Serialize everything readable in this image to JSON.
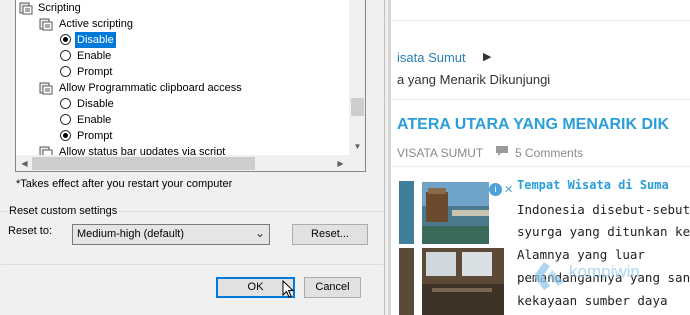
{
  "dialog": {
    "tree": {
      "items": [
        {
          "label": "Scripting",
          "kind": "category"
        },
        {
          "label": "Active scripting",
          "kind": "setting"
        },
        {
          "label": "Disable",
          "kind": "option",
          "checked": true,
          "selected": true
        },
        {
          "label": "Enable",
          "kind": "option",
          "checked": false
        },
        {
          "label": "Prompt",
          "kind": "option",
          "checked": false
        },
        {
          "label": "Allow Programmatic clipboard access",
          "kind": "setting"
        },
        {
          "label": "Disable",
          "kind": "option",
          "checked": false
        },
        {
          "label": "Enable",
          "kind": "option",
          "checked": false
        },
        {
          "label": "Prompt",
          "kind": "option",
          "checked": true
        },
        {
          "label": "Allow status bar updates via script",
          "kind": "setting"
        }
      ]
    },
    "note": "*Takes effect after you restart your computer",
    "reset_group": {
      "title": "Reset custom settings",
      "reset_to_label": "Reset to:",
      "reset_to_value": "Medium-high (default)",
      "reset_button": "Reset..."
    },
    "ok_button": "OK",
    "cancel_button": "Cancel"
  },
  "webpage": {
    "breadcrumb_link": "isata Sumut",
    "breadcrumb_title": "a yang Menarik Dikunjungi",
    "post_title": "ATERA UTARA YANG MENARIK DIK",
    "category": "VISATA SUMUT",
    "comments": "5 Comments",
    "article_heading": "Tempat Wisata di Suma",
    "article_lines": [
      "Indonesia disebut-sebut sel",
      "syurga yang ditunkan ke",
      "Alamnya      yang     luar",
      "pemandangannya yang sang",
      "kekayaan sumber daya"
    ],
    "watermark": "kompiwin",
    "adchoices_icon": "i",
    "ad_close_icon": "✕"
  },
  "colors": {
    "selection": "#0078d7",
    "link": "#2a9fd8",
    "dialog_bg": "#f0f0f0"
  }
}
